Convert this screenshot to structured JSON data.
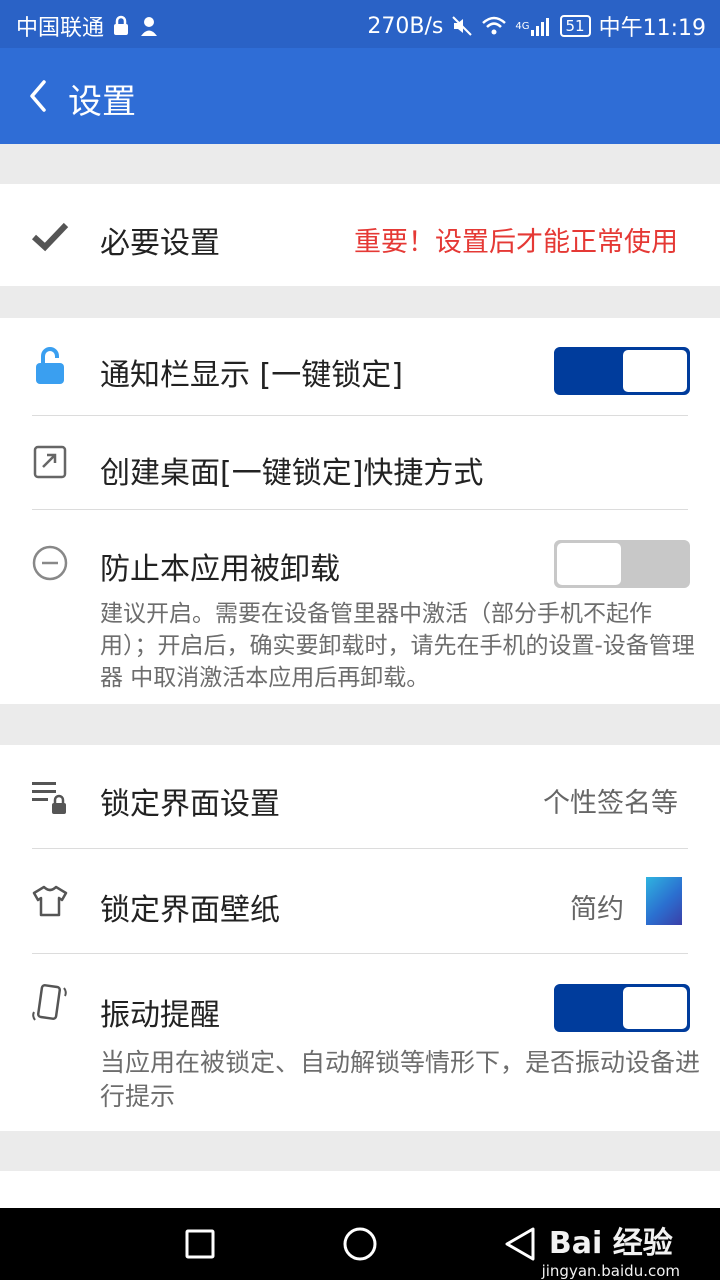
{
  "status_bar": {
    "carrier": "中国联通",
    "speed": "270B/s",
    "network": "4G",
    "battery": "51",
    "time": "中午11:19"
  },
  "app_bar": {
    "title": "设置"
  },
  "essential": {
    "label": "必要设置",
    "hint": "重要！设置后才能正常使用"
  },
  "notification": {
    "label": "通知栏显示 [一键锁定]",
    "enabled": true
  },
  "shortcut": {
    "label": "创建桌面[一键锁定]快捷方式"
  },
  "uninstall": {
    "label": "防止本应用被卸载",
    "enabled": false,
    "description": "建议开启。需要在设备管里器中激活（部分手机不起作用）；开启后，确实要卸载时，请先在手机的设置-设备管理器 中取消激活本应用后再卸载。"
  },
  "lock_screen": {
    "label": "锁定界面设置",
    "value": "个性签名等"
  },
  "wallpaper": {
    "label": "锁定界面壁纸",
    "value": "简约"
  },
  "vibration": {
    "label": "振动提醒",
    "enabled": true,
    "description": "当应用在被锁定、自动解锁等情形下，是否振动设备进行提示"
  },
  "watermark": {
    "brand": "Bai 经验",
    "url": "jingyan.baidu.com"
  },
  "colors": {
    "status_bar": "#2a62c6",
    "app_bar": "#2f6dd6",
    "toggle_on": "#003c9c",
    "toggle_off": "#c8c8c8",
    "warning_text": "#e53935"
  }
}
